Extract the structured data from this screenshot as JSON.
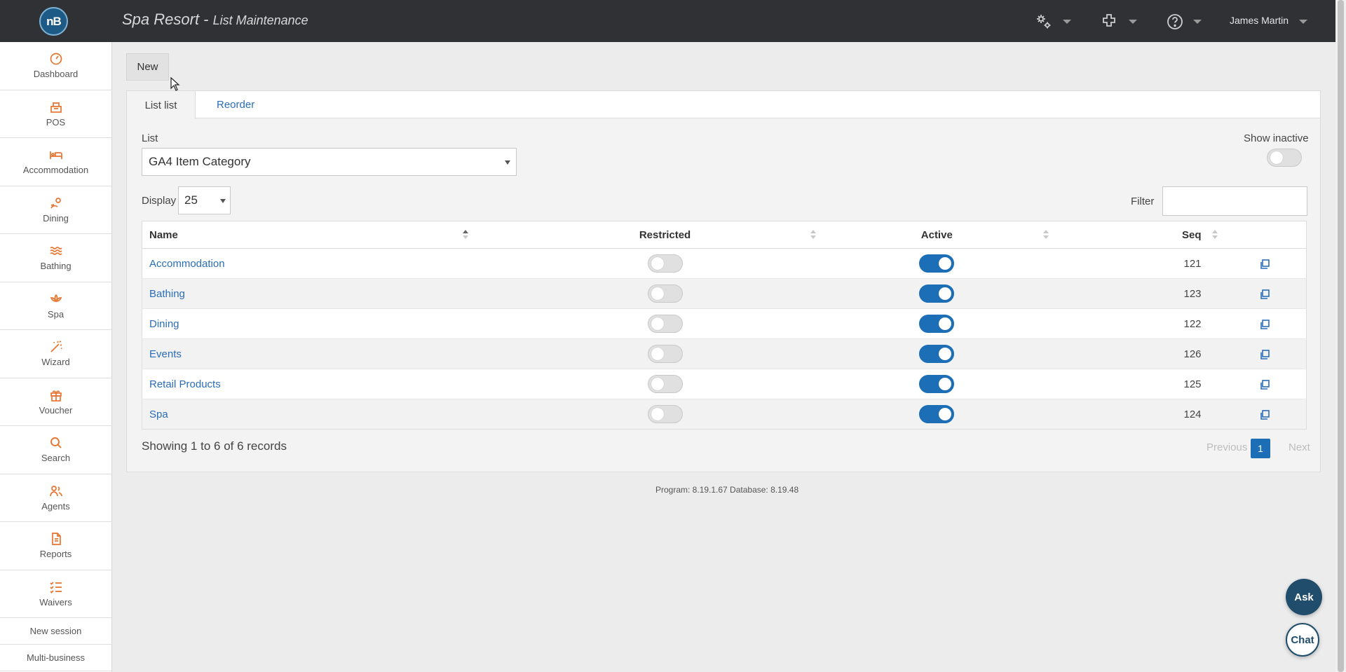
{
  "header": {
    "logo_text": "nB",
    "app_title": "Spa Resort - ",
    "app_subtitle": "List Maintenance",
    "user_name": "James Martin"
  },
  "sidebar": {
    "items": [
      {
        "label": "Dashboard",
        "icon": "dashboard-icon"
      },
      {
        "label": "POS",
        "icon": "pos-icon"
      },
      {
        "label": "Accommodation",
        "icon": "bed-icon"
      },
      {
        "label": "Dining",
        "icon": "dining-icon"
      },
      {
        "label": "Bathing",
        "icon": "waves-icon"
      },
      {
        "label": "Spa",
        "icon": "lotus-icon"
      },
      {
        "label": "Wizard",
        "icon": "wand-icon"
      },
      {
        "label": "Voucher",
        "icon": "gift-icon"
      },
      {
        "label": "Search",
        "icon": "search-icon"
      },
      {
        "label": "Agents",
        "icon": "agents-icon"
      },
      {
        "label": "Reports",
        "icon": "report-icon"
      },
      {
        "label": "Waivers",
        "icon": "checklist-icon"
      }
    ],
    "links": [
      "New session",
      "Multi-business"
    ],
    "accent": "#e8742e"
  },
  "toolbar": {
    "new_label": "New"
  },
  "tabs": {
    "list_list": "List list",
    "reorder": "Reorder"
  },
  "form": {
    "list_label": "List",
    "list_value": "GA4 Item Category",
    "show_inactive_label": "Show inactive",
    "show_inactive": false,
    "display_label": "Display",
    "display_value": "25",
    "filter_label": "Filter",
    "filter_value": ""
  },
  "table": {
    "headers": {
      "name": "Name",
      "restricted": "Restricted",
      "active": "Active",
      "seq": "Seq"
    },
    "rows": [
      {
        "name": "Accommodation",
        "restricted": false,
        "active": true,
        "seq": "121"
      },
      {
        "name": "Bathing",
        "restricted": false,
        "active": true,
        "seq": "123"
      },
      {
        "name": "Dining",
        "restricted": false,
        "active": true,
        "seq": "122"
      },
      {
        "name": "Events",
        "restricted": false,
        "active": true,
        "seq": "126"
      },
      {
        "name": "Retail Products",
        "restricted": false,
        "active": true,
        "seq": "125"
      },
      {
        "name": "Spa",
        "restricted": false,
        "active": true,
        "seq": "124"
      }
    ]
  },
  "footer": {
    "records_text": "Showing 1 to 6 of 6 records",
    "prev_label": "Previous",
    "page": "1",
    "next_label": "Next",
    "version": "Program: 8.19.1.67 Database: 8.19.48"
  },
  "fab": {
    "ask": "Ask",
    "chat": "Chat"
  },
  "colors": {
    "primary": "#1c6fb7",
    "topbar": "#2f3135",
    "link": "#2a6db8"
  }
}
